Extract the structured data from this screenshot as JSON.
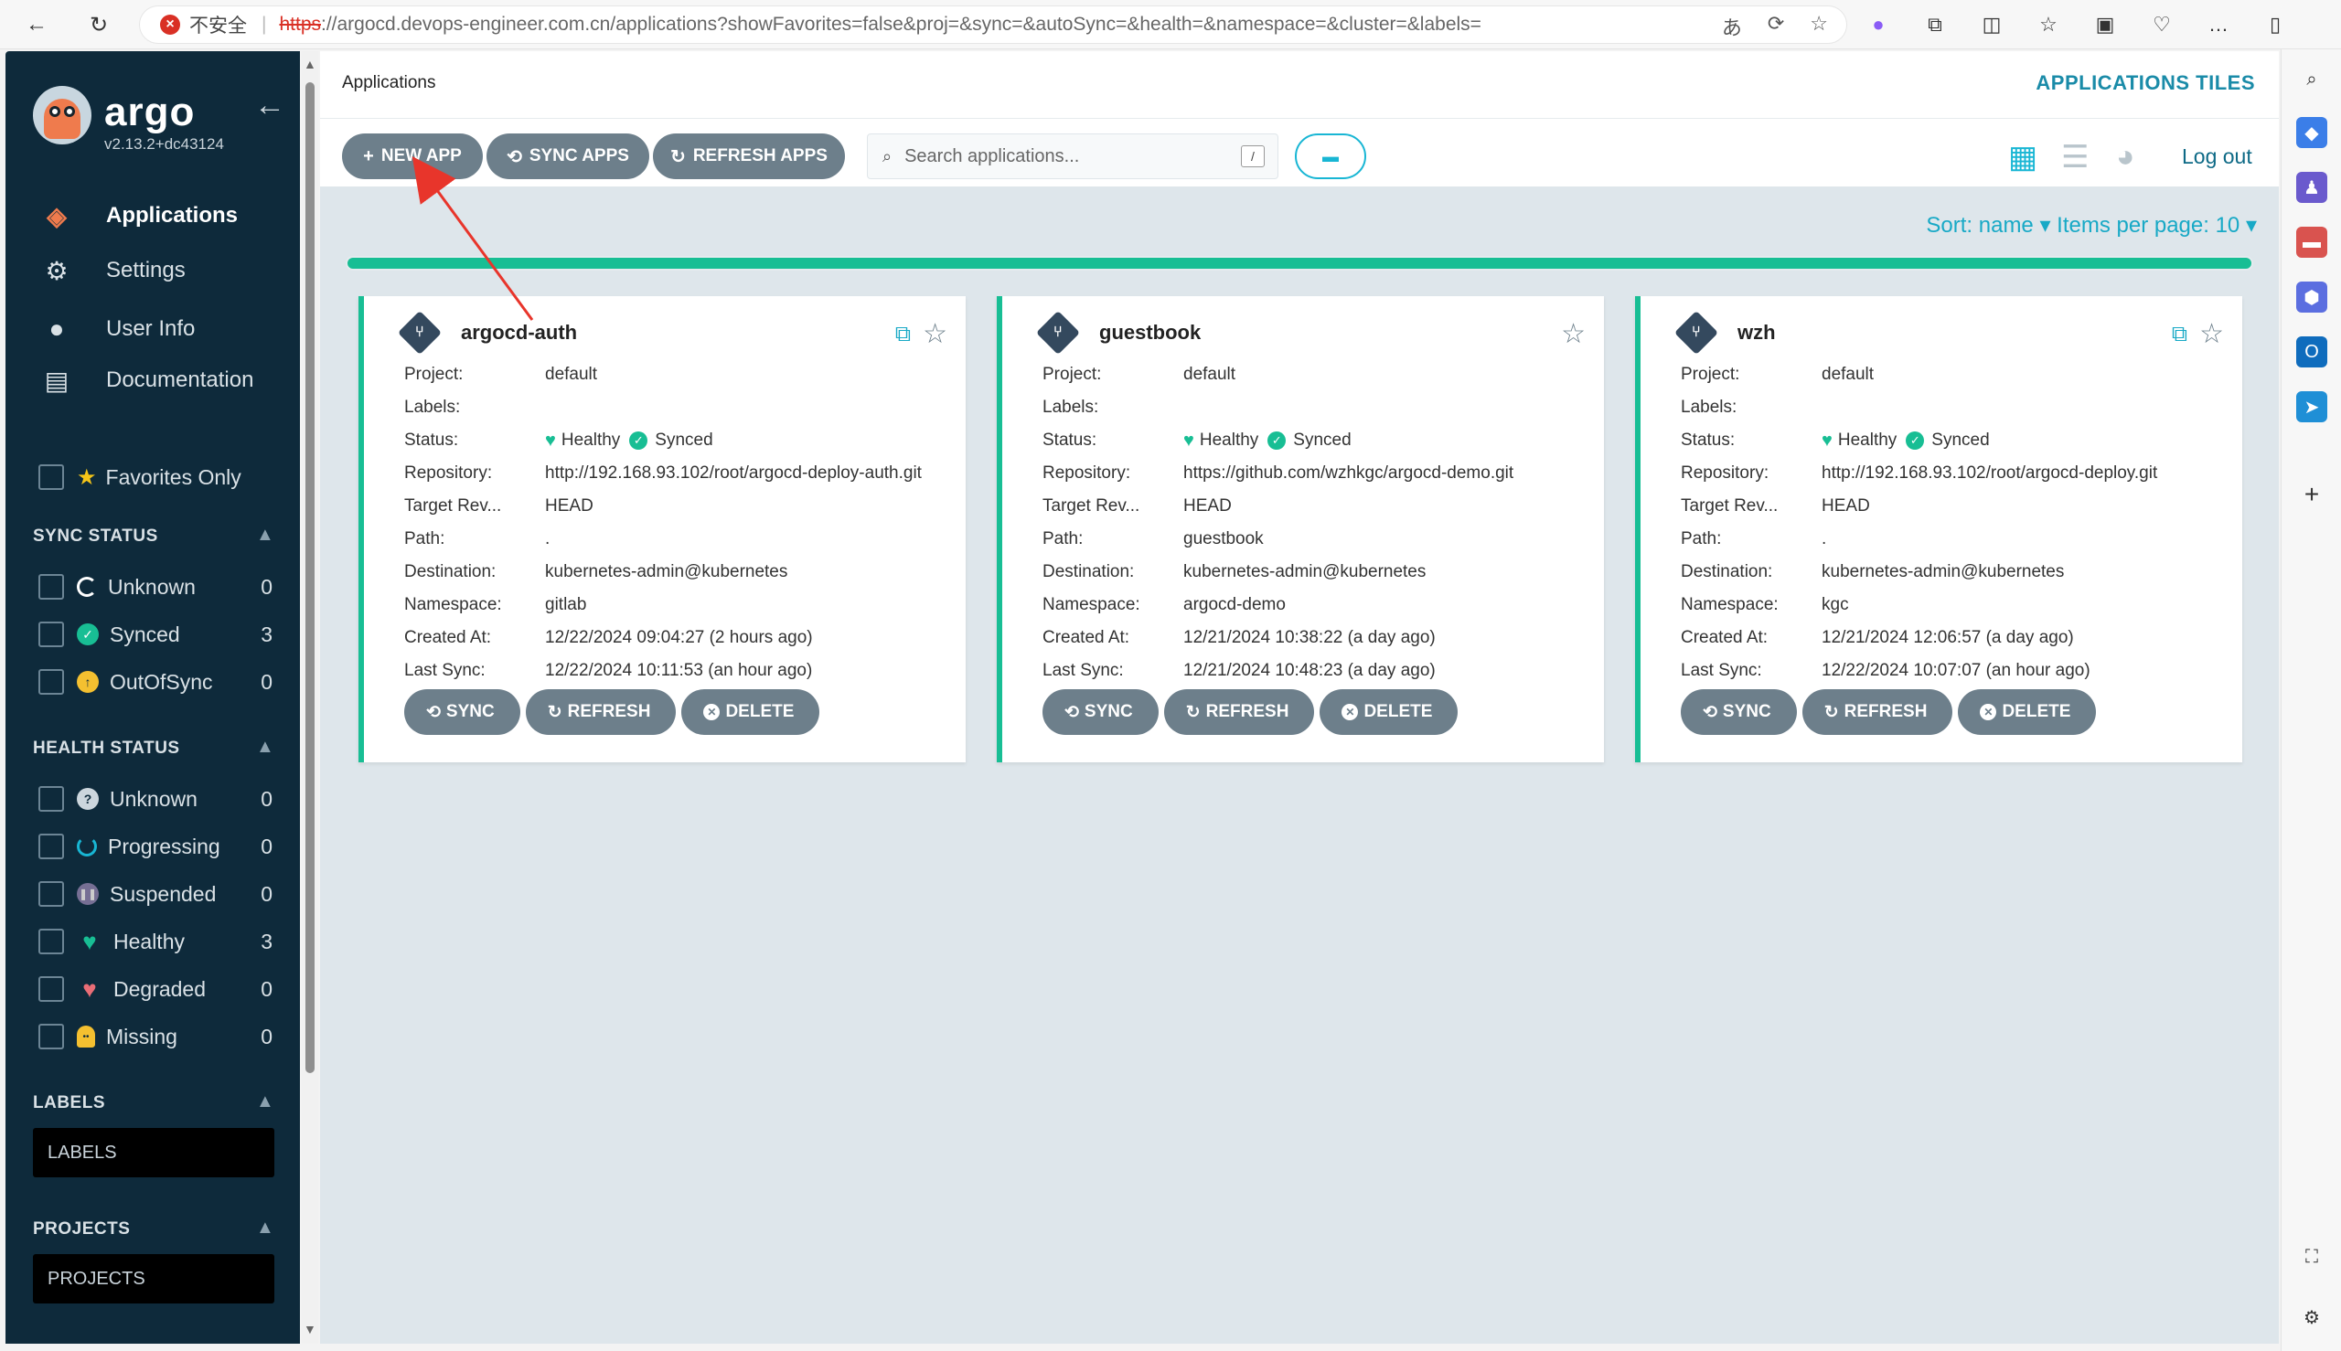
{
  "browser": {
    "insecure_label": "不安全",
    "url_protocol": "https",
    "url_rest": "://argocd.devops-engineer.com.cn/applications?showFavorites=false&proj=&sync=&autoSync=&health=&namespace=&cluster=&labels="
  },
  "sidebar": {
    "brand": "argo",
    "version": "v2.13.2+dc43124",
    "nav": [
      {
        "label": "Applications",
        "icon": "layers-icon"
      },
      {
        "label": "Settings",
        "icon": "gear-icon"
      },
      {
        "label": "User Info",
        "icon": "user-circle-icon"
      },
      {
        "label": "Documentation",
        "icon": "book-icon"
      }
    ],
    "favorites_label": "Favorites Only",
    "sync_status_title": "SYNC STATUS",
    "sync_status": [
      {
        "label": "Unknown",
        "count": "0"
      },
      {
        "label": "Synced",
        "count": "3"
      },
      {
        "label": "OutOfSync",
        "count": "0"
      }
    ],
    "health_status_title": "HEALTH STATUS",
    "health_status": [
      {
        "label": "Unknown",
        "count": "0"
      },
      {
        "label": "Progressing",
        "count": "0"
      },
      {
        "label": "Suspended",
        "count": "0"
      },
      {
        "label": "Healthy",
        "count": "3"
      },
      {
        "label": "Degraded",
        "count": "0"
      },
      {
        "label": "Missing",
        "count": "0"
      }
    ],
    "labels_title": "LABELS",
    "labels_placeholder": "LABELS",
    "projects_title": "PROJECTS",
    "projects_placeholder": "PROJECTS"
  },
  "header": {
    "page_title": "Applications",
    "view_title": "APPLICATIONS TILES"
  },
  "toolbar": {
    "new_app": "NEW APP",
    "sync_apps": "SYNC APPS",
    "refresh_apps": "REFRESH APPS",
    "search_placeholder": "Search applications...",
    "search_shortcut": "/",
    "logout": "Log out"
  },
  "sort": {
    "text": "Sort: name ▾ Items per page: 10 ▾"
  },
  "row_labels": {
    "project": "Project:",
    "labels": "Labels:",
    "status": "Status:",
    "repository": "Repository:",
    "target": "Target Rev...",
    "path": "Path:",
    "destination": "Destination:",
    "namespace": "Namespace:",
    "created": "Created At:",
    "last_sync": "Last Sync:"
  },
  "card_buttons": {
    "sync": "SYNC",
    "refresh": "REFRESH",
    "delete": "DELETE"
  },
  "apps": [
    {
      "name": "argocd-auth",
      "project": "default",
      "labels": "",
      "health": "Healthy",
      "sync": "Synced",
      "repository": "http://192.168.93.102/root/argocd-deploy-auth.git",
      "target": "HEAD",
      "path": ".",
      "destination": "kubernetes-admin@kubernetes",
      "namespace": "gitlab",
      "created": "12/22/2024 09:04:27  (2 hours ago)",
      "last_sync": "12/22/2024 10:11:53  (an hour ago)"
    },
    {
      "name": "guestbook",
      "project": "default",
      "labels": "",
      "health": "Healthy",
      "sync": "Synced",
      "repository": "https://github.com/wzhkgc/argocd-demo.git",
      "target": "HEAD",
      "path": "guestbook",
      "destination": "kubernetes-admin@kubernetes",
      "namespace": "argocd-demo",
      "created": "12/21/2024 10:38:22  (a day ago)",
      "last_sync": "12/21/2024 10:48:23  (a day ago)"
    },
    {
      "name": "wzh",
      "project": "default",
      "labels": "",
      "health": "Healthy",
      "sync": "Synced",
      "repository": "http://192.168.93.102/root/argocd-deploy.git",
      "target": "HEAD",
      "path": ".",
      "destination": "kubernetes-admin@kubernetes",
      "namespace": "kgc",
      "created": "12/21/2024 12:06:57  (a day ago)",
      "last_sync": "12/22/2024 10:07:07  (an hour ago)"
    }
  ],
  "colors": {
    "sidebar_bg": "#0e2a3b",
    "accent": "#18be94",
    "link": "#18a9c6",
    "button": "#6d7f8b"
  }
}
